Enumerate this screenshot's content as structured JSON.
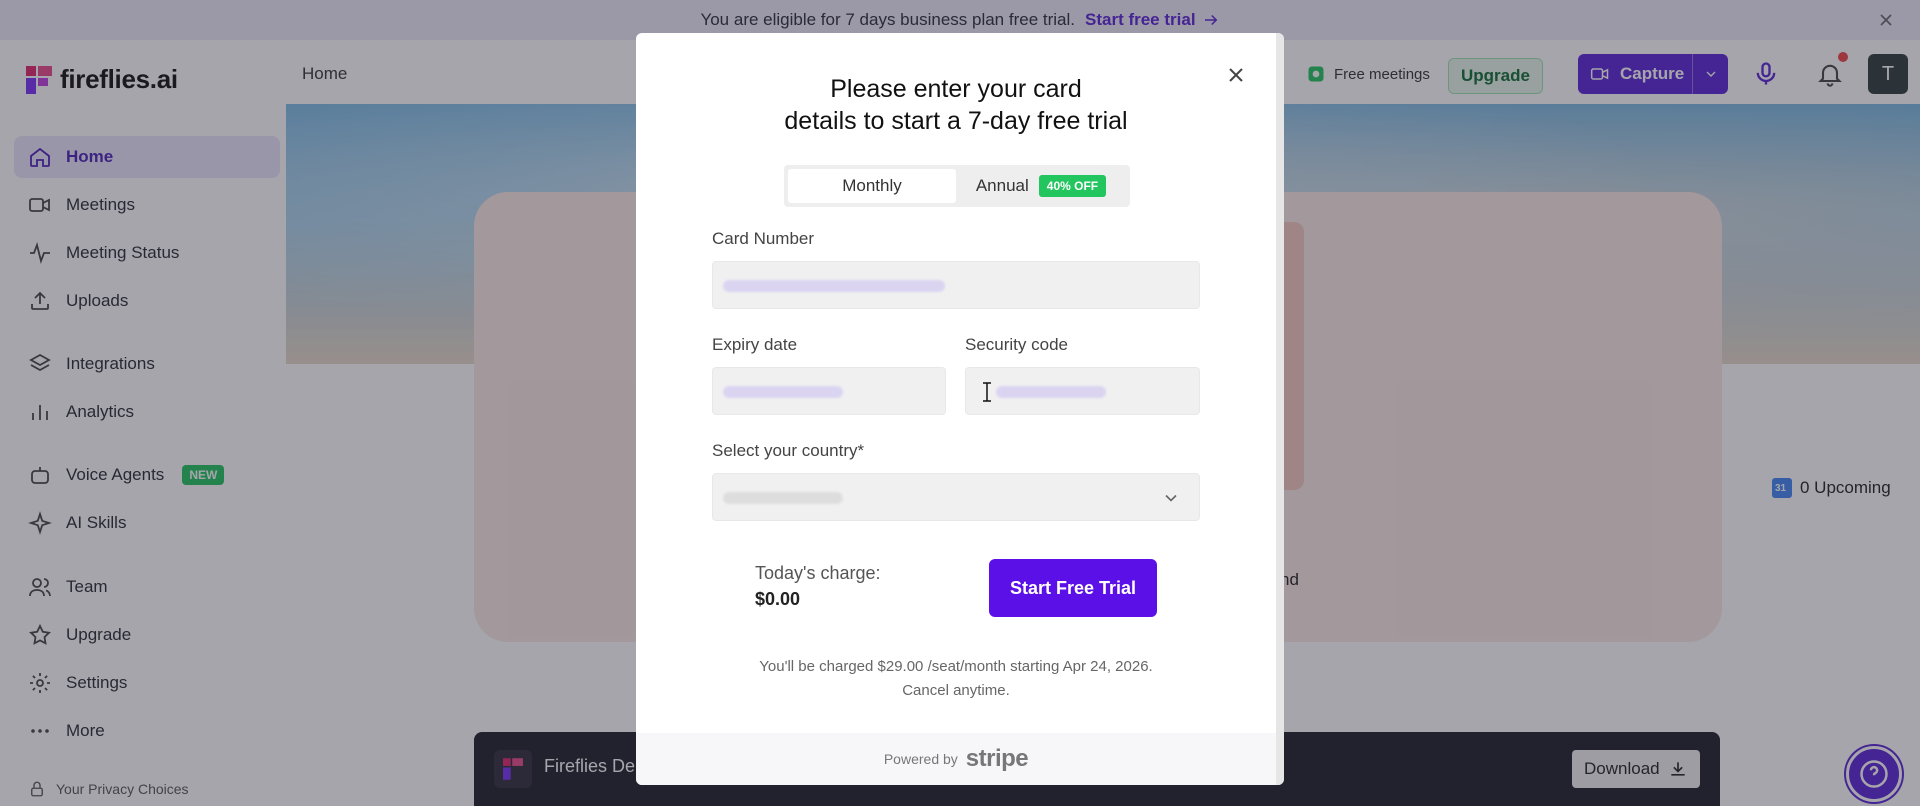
{
  "banner": {
    "message": "You are eligible for 7 days business plan free trial.",
    "cta": "Start free trial"
  },
  "app": {
    "logo": "fireflies.ai",
    "page_title": "Home"
  },
  "sidebar": {
    "items": [
      {
        "label": "Home"
      },
      {
        "label": "Meetings"
      },
      {
        "label": "Meeting Status"
      },
      {
        "label": "Uploads"
      },
      {
        "label": "Integrations"
      },
      {
        "label": "Analytics"
      },
      {
        "label": "Voice Agents",
        "badge": "NEW"
      },
      {
        "label": "AI Skills"
      },
      {
        "label": "Team"
      },
      {
        "label": "Upgrade"
      },
      {
        "label": "Settings"
      },
      {
        "label": "More"
      }
    ],
    "privacy": "Your Privacy Choices"
  },
  "header": {
    "free_meetings": "Free meetings",
    "upgrade": "Upgrade",
    "capture": "Capture",
    "avatar_initial": "T"
  },
  "main": {
    "upcoming": "0 Upcoming",
    "peek_text": "nd",
    "download_bar": {
      "title": "Fireflies De",
      "button": "Download"
    }
  },
  "modal": {
    "title_line1": "Please enter your card",
    "title_line2": "details to start a 7-day free trial",
    "billing": {
      "monthly": "Monthly",
      "annual": "Annual",
      "annual_badge": "40% OFF",
      "selected": "Monthly"
    },
    "card_number_label": "Card Number",
    "expiry_label": "Expiry date",
    "security_label": "Security code",
    "country_label": "Select your country*",
    "charge_label": "Today's charge:",
    "charge_value": "$0.00",
    "start_button": "Start Free Trial",
    "fine_print_line1": "You'll be charged $29.00  /seat/month starting Apr 24, 2026.",
    "fine_print_line2": "Cancel anytime.",
    "powered_by": "Powered by",
    "stripe": "stripe"
  },
  "colors": {
    "brand": "#5b21d6",
    "cta_button": "#5b10e8",
    "badge_green": "#22c55e"
  }
}
